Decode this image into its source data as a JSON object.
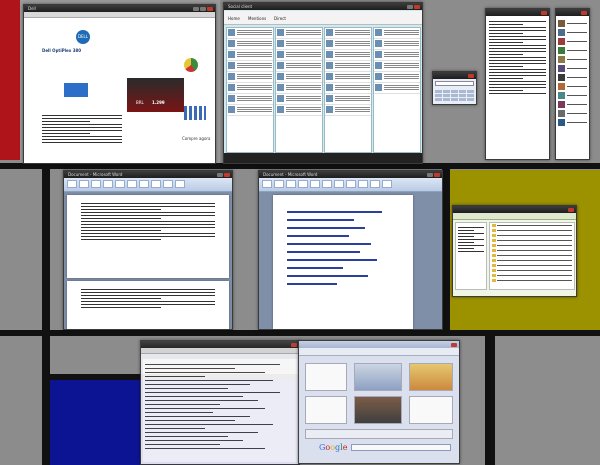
{
  "desktop": {
    "background": "mondrian",
    "colors": {
      "red": "#b0141b",
      "blue": "#0d1494",
      "yellow": "#9c9200",
      "black": "#111111"
    }
  },
  "windows": {
    "browser1": {
      "title": "Dell",
      "brand": "DELL",
      "headline": "Dell OptiPlex 380",
      "price": "1.299",
      "price_label": "BRL",
      "promo": "Compre agora"
    },
    "social": {
      "title": "Social client",
      "tabs": [
        "Home",
        "Mentions",
        "Direct"
      ]
    },
    "small1": {
      "title": ""
    },
    "small2": {
      "title": ""
    },
    "calc": {
      "title": ""
    },
    "word1": {
      "title": "Document - Microsoft Word"
    },
    "word2": {
      "title": "Document - Microsoft Word"
    },
    "explorer": {
      "title": ""
    },
    "term": {
      "title": ""
    },
    "chrome": {
      "logo": "Google"
    }
  }
}
